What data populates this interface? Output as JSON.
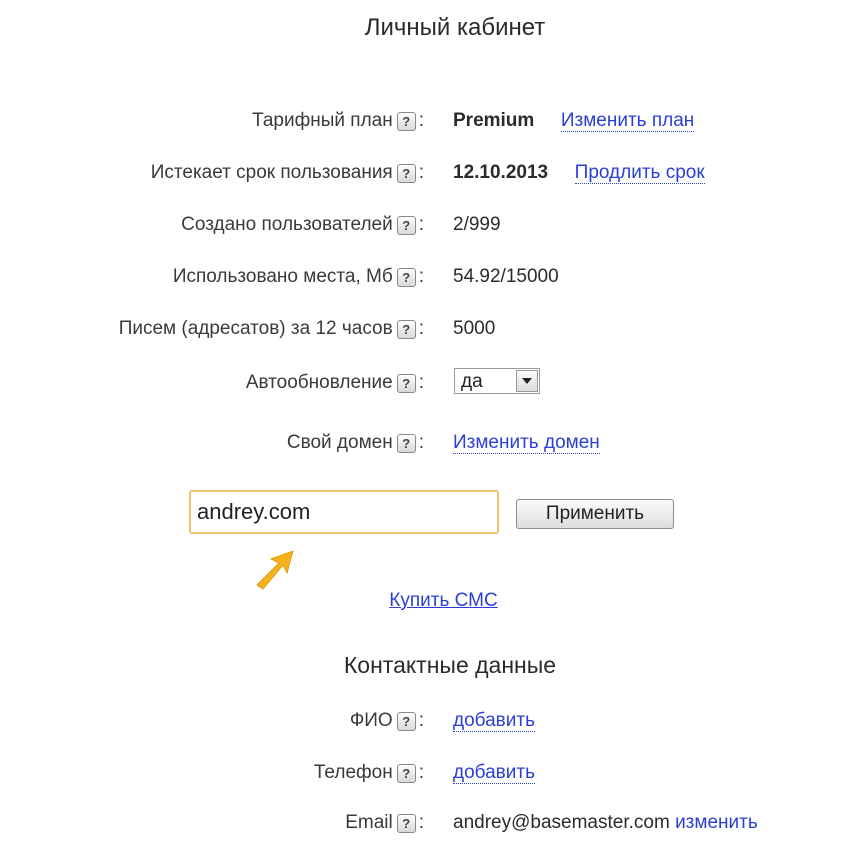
{
  "page": {
    "title": "Личный кабинет"
  },
  "account": {
    "plan": {
      "label": "Тарифный план",
      "value": "Premium",
      "action": "Изменить план"
    },
    "expires": {
      "label": "Истекает срок пользования",
      "value": "12.10.2013",
      "action": "Продлить срок"
    },
    "users": {
      "label": "Создано пользователей",
      "value": "2/999"
    },
    "space": {
      "label": "Использовано места, Мб",
      "value": "54.92/15000"
    },
    "letters": {
      "label": "Писем (адресатов) за 12 часов",
      "value": "5000"
    },
    "autoupdate": {
      "label": "Автообновление",
      "value": "да"
    },
    "domain": {
      "label": "Свой домен",
      "action": "Изменить домен",
      "input_value": "andrey.com",
      "apply": "Применить"
    },
    "buy_sms": "Купить СМС"
  },
  "contacts": {
    "title": "Контактные данные",
    "fio": {
      "label": "ФИО",
      "action": "добавить"
    },
    "phone": {
      "label": "Телефон",
      "action": "добавить"
    },
    "email": {
      "label": "Email",
      "value": "andrey@basemaster.com",
      "action": "изменить"
    }
  },
  "icons": {
    "help": "?",
    "arrow": "arrow-up-right-icon",
    "dropdown": "chevron-down-icon"
  },
  "colors": {
    "link": "#2a3fd6",
    "input_border": "#f0c36a",
    "arrow": "#f4b21c"
  }
}
